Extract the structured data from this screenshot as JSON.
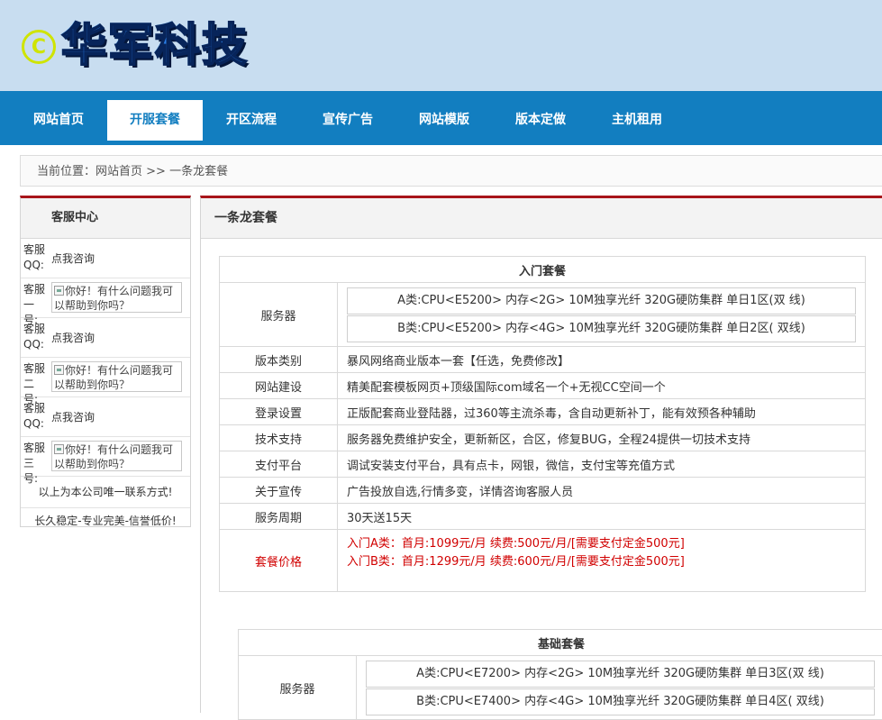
{
  "site": {
    "logo_mark": "C",
    "logo_text": "华军科技"
  },
  "nav": {
    "items": [
      {
        "label": "网站首页",
        "active": false
      },
      {
        "label": "开服套餐",
        "active": true
      },
      {
        "label": "开区流程",
        "active": false
      },
      {
        "label": "宣传广告",
        "active": false
      },
      {
        "label": "网站模版",
        "active": false
      },
      {
        "label": "版本定做",
        "active": false
      },
      {
        "label": "主机租用",
        "active": false
      }
    ]
  },
  "breadcrumb": {
    "prefix": "当前位置：",
    "home": "网站首页",
    "sep": " >> ",
    "current": "一条龙套餐"
  },
  "sidebar": {
    "title": "客服中心",
    "rows": [
      {
        "label": "客服QQ:",
        "link": "点我咨询"
      },
      {
        "label": "客服一号:",
        "img_alt": "你好！有什么问题我可以帮助到你吗？"
      },
      {
        "label": "客服QQ:",
        "link": "点我咨询"
      },
      {
        "label": "客服二号:",
        "img_alt": "你好！有什么问题我可以帮助到你吗？"
      },
      {
        "label": "客服QQ:",
        "link": "点我咨询"
      },
      {
        "label": "客服三号:",
        "img_alt": "你好！有什么问题我可以帮助到你吗？"
      }
    ],
    "note1": "以上为本公司唯一联系方式!",
    "note2": "长久稳定-专业完美-信誉低价!"
  },
  "main": {
    "title": "一条龙套餐",
    "packages": [
      {
        "title": "入门套餐",
        "server_label": "服务器",
        "servers": [
          "A类:CPU<E5200> 内存<2G> 10M独享光纤 320G硬防集群 单日1区(双 线)",
          "B类:CPU<E5200> 内存<4G> 10M独享光纤 320G硬防集群 单日2区( 双线)"
        ],
        "rows": [
          {
            "label": "版本类别",
            "value": "暴风网络商业版本一套【任选，免费修改】"
          },
          {
            "label": "网站建设",
            "value": "精美配套模板网页+顶级国际com域名一个+无视CC空间一个"
          },
          {
            "label": "登录设置",
            "value": "正版配套商业登陆器，过360等主流杀毒，含自动更新补丁，能有效预各种辅助"
          },
          {
            "label": "技术支持",
            "value": "服务器免费维护安全，更新新区，合区，修复BUG，全程24提供一切技术支持"
          },
          {
            "label": "支付平台",
            "value": "调试安装支付平台，具有点卡，网银，微信，支付宝等充值方式"
          },
          {
            "label": "关于宣传",
            "value": "广告投放自选,行情多变，详情咨询客服人员"
          },
          {
            "label": "服务周期",
            "value": "30天送15天"
          }
        ],
        "price_label": "套餐价格",
        "prices": [
          "入门A类：首月:1099元/月 续费:500元/月/[需要支付定金500元]",
          "入门B类：首月:1299元/月 续费:600元/月/[需要支付定金500元]"
        ]
      },
      {
        "title": "基础套餐",
        "server_label": "服务器",
        "servers": [
          "A类:CPU<E7200> 内存<2G> 10M独享光纤 320G硬防集群 单日3区(双 线)",
          "B类:CPU<E7400> 内存<4G> 10M独享光纤 320G硬防集群 单日4区( 双线)"
        ]
      }
    ]
  }
}
